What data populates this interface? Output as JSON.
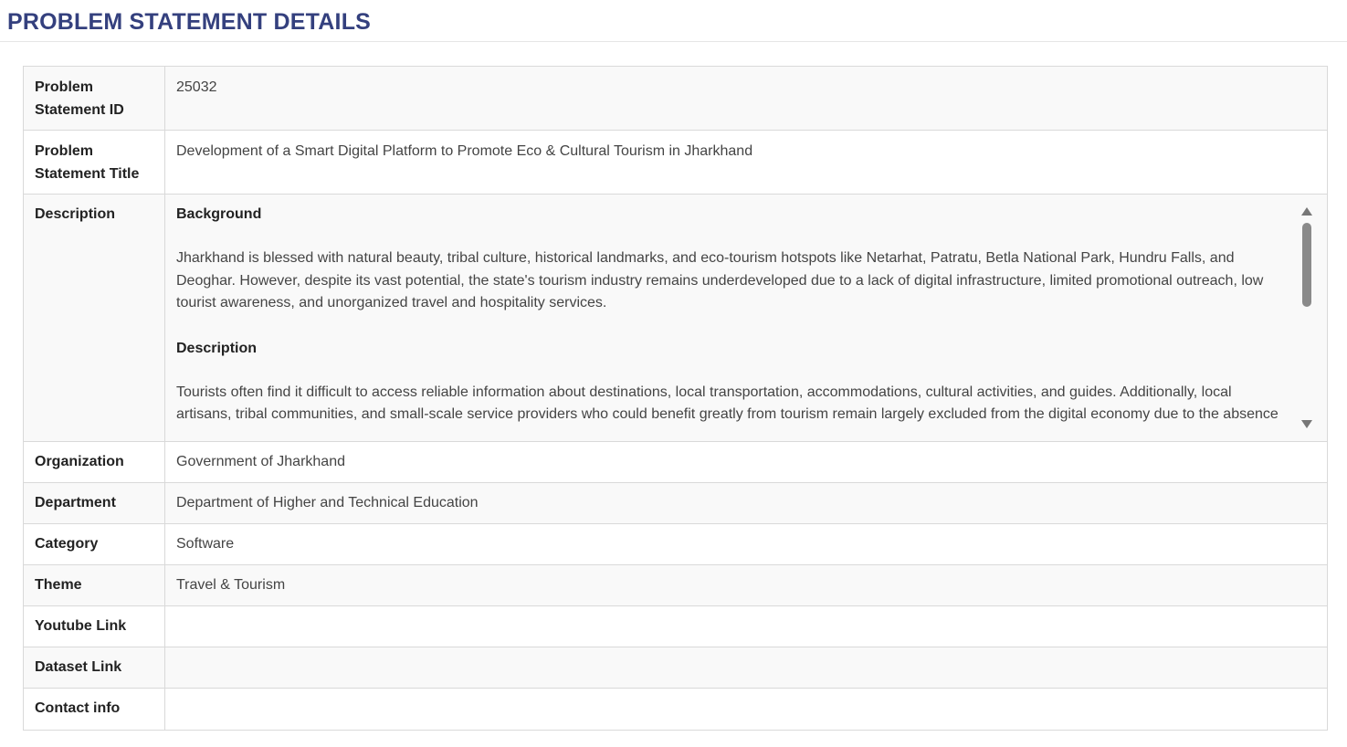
{
  "page": {
    "title": "PROBLEM STATEMENT DETAILS"
  },
  "rows": {
    "id": {
      "label": "Problem Statement ID",
      "value": "25032"
    },
    "title": {
      "label": "Problem Statement Title",
      "value": "Development of a Smart Digital Platform to Promote Eco & Cultural Tourism in Jharkhand"
    },
    "description": {
      "label": "Description",
      "background_heading": "Background",
      "background_text": "Jharkhand is blessed with natural beauty, tribal culture, historical landmarks, and eco-tourism hotspots like Netarhat, Patratu, Betla National Park, Hundru Falls, and Deoghar. However, despite its vast potential, the state's tourism industry remains underdeveloped due to a lack of digital infrastructure, limited promotional outreach, low tourist awareness, and unorganized travel and hospitality services.",
      "description_heading": "Description",
      "description_text": "Tourists often find it difficult to access reliable information about destinations, local transportation, accommodations, cultural activities, and guides. Additionally, local artisans, tribal communities, and small-scale service providers who could benefit greatly from tourism remain largely excluded from the digital economy due to the absence of an integrated platform that connects them with tourists."
    },
    "organization": {
      "label": "Organization",
      "value": "Government of Jharkhand"
    },
    "department": {
      "label": "Department",
      "value": "Department of Higher and Technical Education"
    },
    "category": {
      "label": "Category",
      "value": "Software"
    },
    "theme": {
      "label": "Theme",
      "value": "Travel & Tourism"
    },
    "youtube": {
      "label": "Youtube Link",
      "value": ""
    },
    "dataset": {
      "label": "Dataset Link",
      "value": ""
    },
    "contact": {
      "label": "Contact info",
      "value": ""
    }
  },
  "icons": {
    "scroll_up": "triangle-up",
    "scroll_down": "triangle-down"
  },
  "colors": {
    "title": "#34407e",
    "row_alt": "#f9f9f9",
    "border": "#d9d9d9"
  }
}
